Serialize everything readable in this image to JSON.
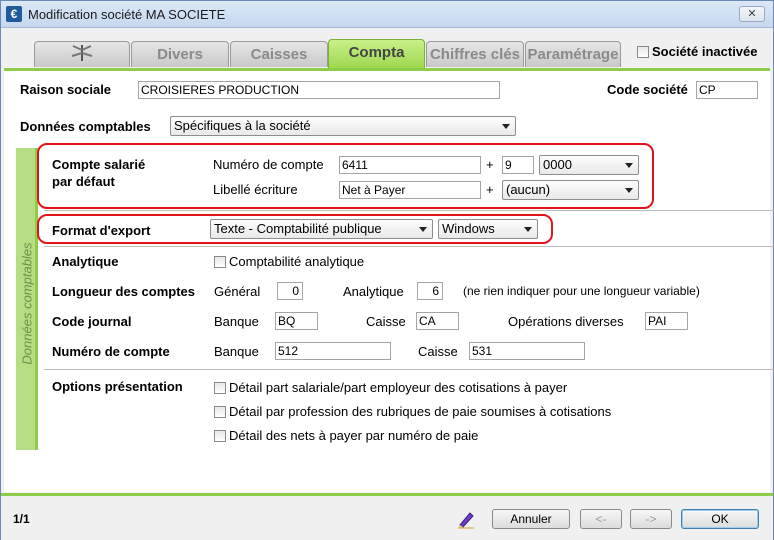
{
  "window": {
    "title": "Modification société MA SOCIETE",
    "close_label": "✕"
  },
  "tabs": [
    {
      "label": "",
      "icon": "dragonfly-icon",
      "active": false
    },
    {
      "label": "Divers",
      "active": false
    },
    {
      "label": "Caisses",
      "active": false
    },
    {
      "label": "Compta",
      "active": true
    },
    {
      "label": "Chiffres clés",
      "active": false
    },
    {
      "label": "Paramétrage",
      "active": false
    }
  ],
  "societe_inactivee": {
    "label": "Société inactivée",
    "checked": false
  },
  "header": {
    "raison_sociale_label": "Raison sociale",
    "raison_sociale_value": "CROISIERES PRODUCTION",
    "code_societe_label": "Code société",
    "code_societe_value": "CP",
    "donnees_comptables_label": "Données comptables",
    "donnees_comptables_value": "Spécifiques à la société"
  },
  "sidebar_label": "Données comptables",
  "compte_salarie": {
    "label_line1": "Compte salarié",
    "label_line2": "par défaut",
    "numero_label": "Numéro de compte",
    "numero_value": "6411",
    "plus1": "+",
    "numero_suffix": "9",
    "numero_select": "0000",
    "libelle_label": "Libellé écriture",
    "libelle_value": "Net à Payer",
    "plus2": "+",
    "libelle_select": "(aucun)"
  },
  "format_export": {
    "label": "Format d'export",
    "format_value": "Texte - Comptabilité publique",
    "os_value": "Windows"
  },
  "analytique": {
    "label": "Analytique",
    "checkbox_label": "Comptabilité analytique",
    "checked": false
  },
  "longueur": {
    "label": "Longueur des comptes",
    "general_label": "Général",
    "general_value": "0",
    "analytique_label": "Analytique",
    "analytique_value": "6",
    "note": "(ne rien indiquer pour une longueur variable)"
  },
  "code_journal": {
    "label": "Code journal",
    "banque_label": "Banque",
    "banque_value": "BQ",
    "caisse_label": "Caisse",
    "caisse_value": "CA",
    "od_label": "Opérations diverses",
    "od_value": "PAI"
  },
  "numero_compte": {
    "label": "Numéro de compte",
    "banque_label": "Banque",
    "banque_value": "512",
    "caisse_label": "Caisse",
    "caisse_value": "531"
  },
  "options": {
    "label": "Options présentation",
    "items": [
      "Détail part salariale/part employeur des cotisations à payer",
      "Détail par profession des rubriques de paie soumises à cotisations",
      "Détail des nets à payer par numéro de paie"
    ]
  },
  "footer": {
    "page_indicator": "1/1",
    "annuler": "Annuler",
    "prev": "<-",
    "next": "->",
    "ok": "OK"
  },
  "colors": {
    "accent_green": "#8fcc47",
    "highlight_red": "#e1141a"
  }
}
